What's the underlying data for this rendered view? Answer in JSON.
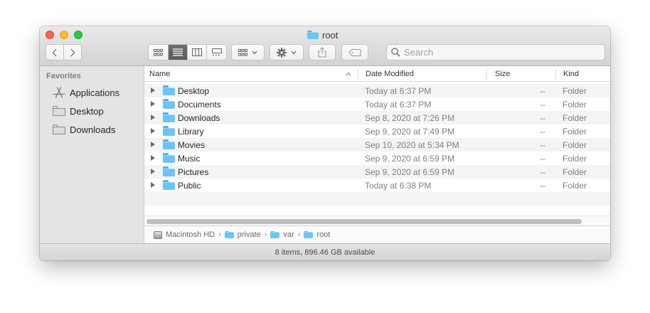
{
  "window": {
    "title": "root",
    "folder_color": "#6cc4f5"
  },
  "toolbar": {
    "nav_back": "back-chevron",
    "nav_forward": "forward-chevron",
    "view_modes": [
      "icon-view",
      "list-view",
      "column-view",
      "gallery-view"
    ],
    "active_view": "list-view",
    "group_by": "group-grid",
    "action": "gear",
    "share": "share",
    "tag": "tag",
    "search_placeholder": "Search"
  },
  "sidebar": {
    "heading": "Favorites",
    "items": [
      {
        "label": "Applications",
        "icon": "applications-icon"
      },
      {
        "label": "Desktop",
        "icon": "folder-icon"
      },
      {
        "label": "Downloads",
        "icon": "folder-icon"
      }
    ]
  },
  "columns": {
    "name": "Name",
    "date": "Date Modified",
    "size": "Size",
    "kind": "Kind",
    "sort_indicator": "^"
  },
  "rows": [
    {
      "name": "Desktop",
      "date": "Today at 6:37 PM",
      "size": "--",
      "kind": "Folder"
    },
    {
      "name": "Documents",
      "date": "Today at 6:37 PM",
      "size": "--",
      "kind": "Folder"
    },
    {
      "name": "Downloads",
      "date": "Sep 8, 2020 at 7:26 PM",
      "size": "--",
      "kind": "Folder"
    },
    {
      "name": "Library",
      "date": "Sep 9, 2020 at 7:49 PM",
      "size": "--",
      "kind": "Folder"
    },
    {
      "name": "Movies",
      "date": "Sep 10, 2020 at 5:34 PM",
      "size": "--",
      "kind": "Folder"
    },
    {
      "name": "Music",
      "date": "Sep 9, 2020 at 6:59 PM",
      "size": "--",
      "kind": "Folder"
    },
    {
      "name": "Pictures",
      "date": "Sep 9, 2020 at 6:59 PM",
      "size": "--",
      "kind": "Folder"
    },
    {
      "name": "Public",
      "date": "Today at 6:38 PM",
      "size": "--",
      "kind": "Folder"
    }
  ],
  "path": [
    "Macintosh HD",
    "private",
    "var",
    "root"
  ],
  "status": "8 items, 896.46 GB available"
}
